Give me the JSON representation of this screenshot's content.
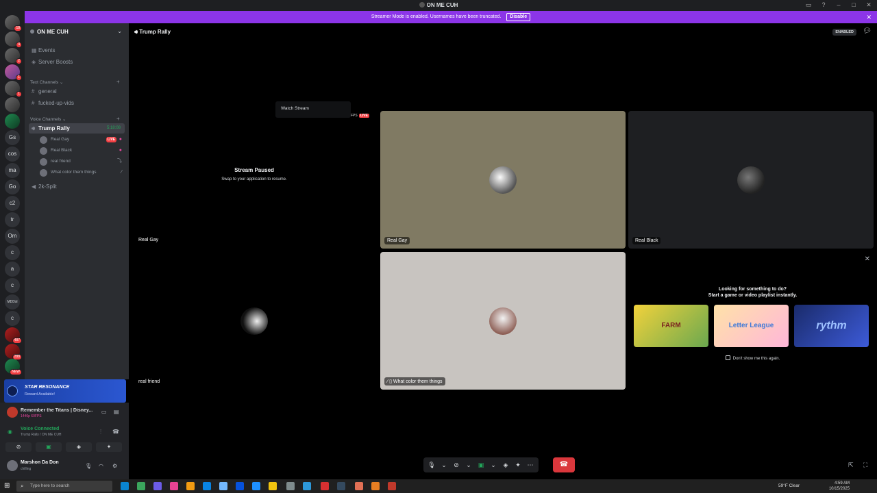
{
  "window": {
    "title": "ON ME CUH",
    "icons": [
      "inbox-icon",
      "help-icon",
      "minimize-icon",
      "maximize-icon",
      "close-icon"
    ]
  },
  "banner": {
    "text": "Streamer Mode is enabled. Usernames have been truncated.",
    "button": "Disable",
    "close": "✕"
  },
  "rail": {
    "servers": [
      {
        "label": "",
        "badge": "18"
      },
      {
        "label": "",
        "badge": "4"
      },
      {
        "label": "",
        "badge": "2"
      },
      {
        "label": "",
        "badge": "1"
      },
      {
        "label": "",
        "badge": "1"
      },
      {
        "label": "",
        "badge": ""
      },
      {
        "label": "",
        "badge": ""
      },
      {
        "label": "Gs",
        "badge": ""
      },
      {
        "label": "cos",
        "badge": ""
      },
      {
        "label": "ma",
        "badge": ""
      },
      {
        "label": "Go",
        "badge": ""
      },
      {
        "label": "c2",
        "badge": ""
      },
      {
        "label": "tr",
        "badge": ""
      },
      {
        "label": "Om",
        "badge": ""
      },
      {
        "label": "c",
        "badge": ""
      },
      {
        "label": "a",
        "badge": ""
      },
      {
        "label": "c",
        "badge": ""
      },
      {
        "label": "MDDsl",
        "badge": ""
      },
      {
        "label": "c",
        "badge": ""
      },
      {
        "label": "",
        "badge": "487"
      },
      {
        "label": "",
        "badge": "288"
      },
      {
        "label": "",
        "badge": "NEW"
      }
    ]
  },
  "sidebar": {
    "server_name": "ON ME CUH",
    "events": "Events",
    "boosts": "Server Boosts",
    "text_category": "Text Channels",
    "text_channels": [
      "general",
      "fucked-up-vids"
    ],
    "voice_category": "Voice Channels",
    "active_voice": {
      "name": "Trump Rally",
      "time": "5:18:08"
    },
    "voice_users": [
      {
        "name": "Real Gay",
        "live": "LIVE"
      },
      {
        "name": "Real Black",
        "live": ""
      },
      {
        "name": "real friend",
        "live": ""
      },
      {
        "name": "What color them things",
        "live": ""
      }
    ],
    "other_voice": "2k-Split"
  },
  "promo": {
    "title": "STAR RESONANCE",
    "subtitle": "Reward Available!"
  },
  "activity": {
    "title": "Remember the Titans | Disney...",
    "sub": "1440p 60FPS"
  },
  "voice_connected": {
    "title": "Voice Connected",
    "sub": "Trump Rally / ON ME CUH"
  },
  "user": {
    "name": "Marshon Da Don",
    "status": "chilling"
  },
  "main": {
    "channel": "Trump Rally",
    "enabled_badge": "ENABLED",
    "watch_stream": "Watch Stream",
    "fps": "FPS",
    "live": "LIVE",
    "paused_title": "Stream Paused",
    "paused_sub": "Swap to your application to resume.",
    "tiles": [
      {
        "name": "Real Gay"
      },
      {
        "name": "Real Gay"
      },
      {
        "name": "Real Black"
      },
      {
        "name": "real friend"
      },
      {
        "name": "What color them things"
      }
    ],
    "activity_prompt_1": "Looking for something to do?",
    "activity_prompt_2": "Start a game or video playlist instantly.",
    "games": [
      "FARM",
      "Letter League",
      "rythm"
    ],
    "dont_show": "Don't show me this again."
  },
  "taskbar": {
    "search_placeholder": "Type here to search",
    "weather": "59°F Clear",
    "time": "4:59 AM",
    "date": "10/15/2025"
  },
  "colors": {
    "banner": "#8c35e8",
    "accent_green": "#23a55a",
    "live_red": "#f23f43",
    "hangup": "#da373c"
  }
}
